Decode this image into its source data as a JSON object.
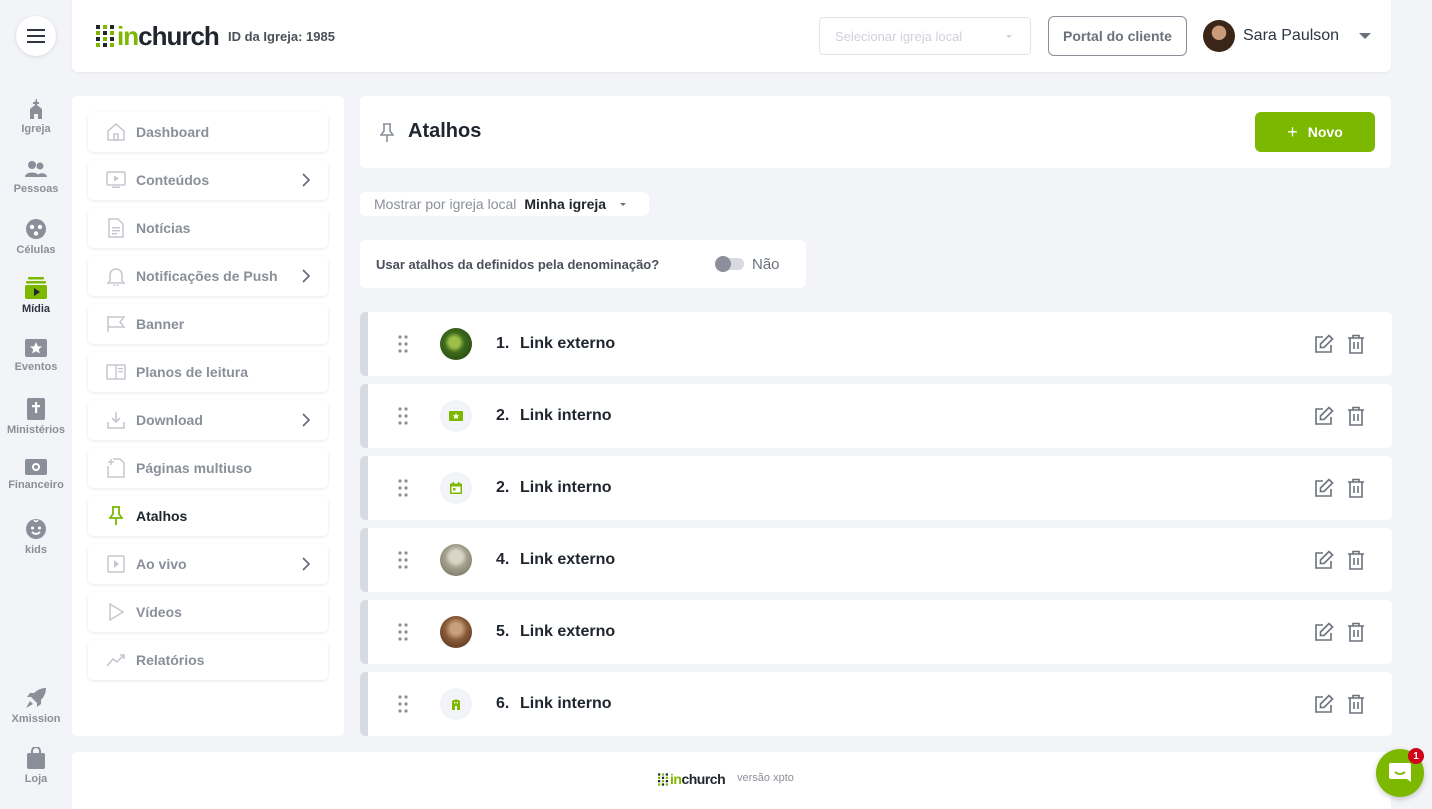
{
  "brand": {
    "logo_in": "in",
    "logo_church": "church",
    "accent": "#7cb800",
    "dark": "#20262e"
  },
  "header": {
    "church_id": "ID da Igreja: 1985",
    "church_select_placeholder": "Selecionar igreja local",
    "portal_button": "Portal do cliente",
    "user_name": "Sara Paulson"
  },
  "rail": {
    "menu_icon": "hamburger-icon",
    "items": [
      {
        "label": "Igreja",
        "icon": "church-icon"
      },
      {
        "label": "Pessoas",
        "icon": "people-icon"
      },
      {
        "label": "Células",
        "icon": "cells-icon"
      },
      {
        "label": "Mídia",
        "icon": "media-icon",
        "active": true
      },
      {
        "label": "Eventos",
        "icon": "events-icon"
      },
      {
        "label": "Ministérios",
        "icon": "ministries-icon"
      },
      {
        "label": "Financeiro",
        "icon": "finance-icon"
      },
      {
        "label": "kids",
        "icon": "kids-icon"
      },
      {
        "label": "Xmission",
        "icon": "rocket-icon"
      },
      {
        "label": "Loja",
        "icon": "shopping-bag-icon"
      }
    ]
  },
  "submenu": {
    "items": [
      {
        "label": "Dashboard",
        "icon": "home-icon"
      },
      {
        "label": "Conteúdos",
        "icon": "play-screen-icon",
        "has_children": true
      },
      {
        "label": "Notícias",
        "icon": "document-icon"
      },
      {
        "label": "Notificações de Push",
        "icon": "bell-icon",
        "has_children": true
      },
      {
        "label": "Banner",
        "icon": "flag-icon"
      },
      {
        "label": "Planos de leitura",
        "icon": "book-icon"
      },
      {
        "label": "Download",
        "icon": "download-icon",
        "has_children": true
      },
      {
        "label": "Páginas multiuso",
        "icon": "page-add-icon"
      },
      {
        "label": "Atalhos",
        "icon": "pin-icon",
        "active": true
      },
      {
        "label": "Ao vivo",
        "icon": "live-icon",
        "has_children": true
      },
      {
        "label": "Vídeos",
        "icon": "video-play-icon"
      },
      {
        "label": "Relatórios",
        "icon": "chart-line-icon"
      }
    ]
  },
  "main": {
    "title": "Atalhos",
    "new_button": "Novo",
    "filter_label": "Mostrar por igreja local",
    "filter_value": "Minha igreja",
    "toggle_label": "Usar atalhos da definidos pela denominação?",
    "toggle_value": "Não",
    "shortcuts": [
      {
        "number": "1.",
        "title": "Link externo",
        "thumb": "photo-plant"
      },
      {
        "number": "2.",
        "title": "Link interno",
        "thumb": "ticket-icon"
      },
      {
        "number": "2.",
        "title": "Link interno",
        "thumb": "calendar-icon"
      },
      {
        "number": "4.",
        "title": "Link externo",
        "thumb": "photo-bird"
      },
      {
        "number": "5.",
        "title": "Link externo",
        "thumb": "photo-person"
      },
      {
        "number": "6.",
        "title": "Link interno",
        "thumb": "kids-face-icon"
      }
    ]
  },
  "footer": {
    "version": "versão xpto"
  },
  "chat": {
    "badge": "1"
  }
}
